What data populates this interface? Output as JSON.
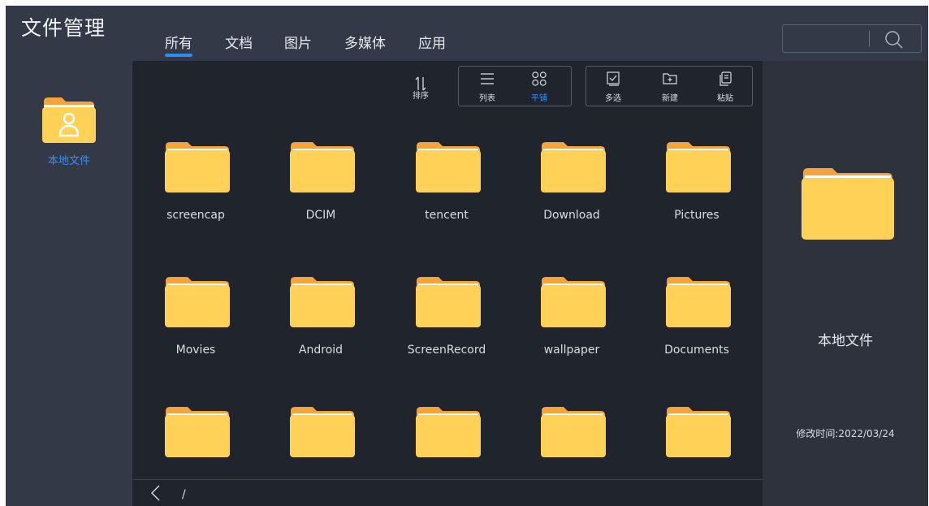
{
  "app": {
    "title": "文件管理"
  },
  "tabs": [
    {
      "label": "所有",
      "active": true
    },
    {
      "label": "文档",
      "active": false
    },
    {
      "label": "图片",
      "active": false
    },
    {
      "label": "多媒体",
      "active": false
    },
    {
      "label": "应用",
      "active": false
    }
  ],
  "search": {
    "placeholder": "",
    "icon": "search-icon"
  },
  "sidebar": {
    "items": [
      {
        "label": "本地文件",
        "icon": "user-folder-icon",
        "selected": true
      }
    ]
  },
  "toolbar": {
    "sort_label": "排序",
    "list_label": "列表",
    "tile_label": "平铺",
    "multiselect_label": "多选",
    "new_label": "新建",
    "paste_label": "粘贴",
    "active_view": "平铺"
  },
  "folders": [
    {
      "name": "screencap"
    },
    {
      "name": "DCIM"
    },
    {
      "name": "tencent"
    },
    {
      "name": "Download"
    },
    {
      "name": "Pictures"
    },
    {
      "name": "Movies"
    },
    {
      "name": "Android"
    },
    {
      "name": "ScreenRecord"
    },
    {
      "name": "wallpaper"
    },
    {
      "name": "Documents"
    },
    {
      "name": ""
    },
    {
      "name": ""
    },
    {
      "name": ""
    },
    {
      "name": ""
    },
    {
      "name": ""
    }
  ],
  "path": "/",
  "detail": {
    "name": "本地文件",
    "modified": "修改时间:2022/03/24"
  },
  "colors": {
    "accent": "#2f8cf0",
    "folder_body": "#ffd257",
    "folder_back": "#f5a33c",
    "background": "#20242d",
    "panel": "#333946"
  }
}
